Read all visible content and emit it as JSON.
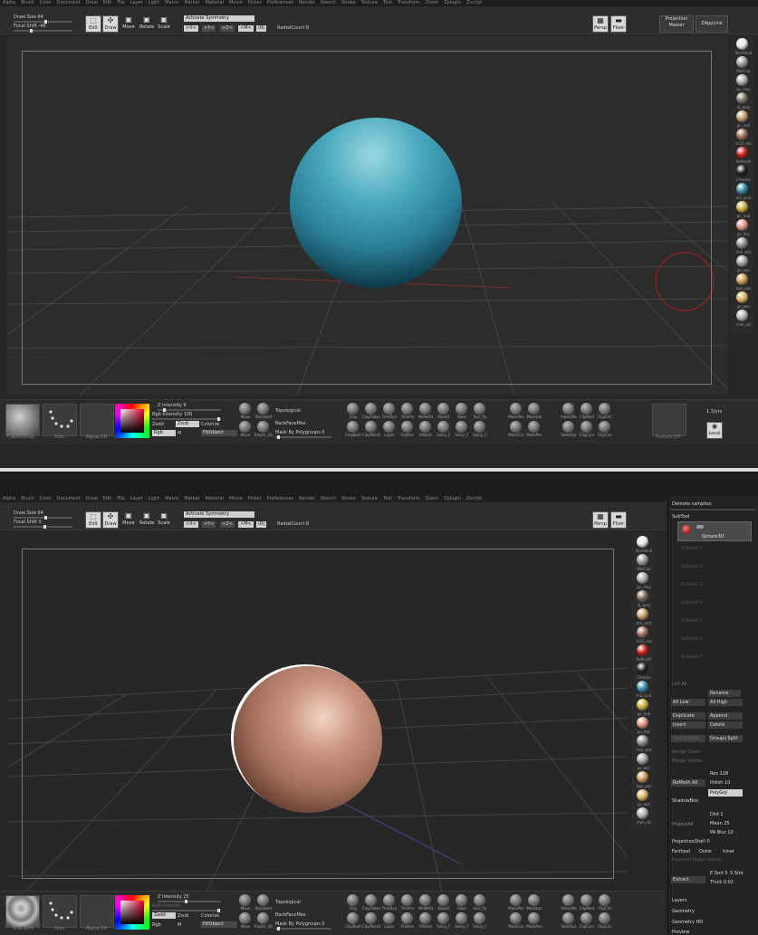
{
  "menu": [
    "Alpha",
    "Brush",
    "Color",
    "Document",
    "Draw",
    "Edit",
    "File",
    "Layer",
    "Light",
    "Macro",
    "Marker",
    "Material",
    "Movie",
    "Picker",
    "Preferences",
    "Render",
    "Stencil",
    "Stroke",
    "Texture",
    "Tool",
    "Transform",
    "Zoom",
    "Zplugin",
    "Zscript"
  ],
  "top1": {
    "draw_size": "Draw Size 64",
    "focal_shift": "Focal Shift -46",
    "symmetry": "Activate Symmetry",
    "axes": [
      ">X<",
      ">Y<",
      ">Z<",
      ">M<",
      "(R)"
    ],
    "radial": "RadialCount 8",
    "edit": "Edit",
    "draw": "Draw",
    "move": "Move",
    "rotate": "Rotate",
    "scale": "Scale",
    "persp": "Persp",
    "floor": "Floor",
    "projection": "Projection Master",
    "zapplink": "ZAppLink"
  },
  "top2": {
    "draw_size": "Draw Size 64",
    "focal_shift": "Focal Shift 0",
    "symmetry": "Activate Symmetry",
    "axes": [
      ">X<",
      ">Y<",
      ">Z<",
      ">M<",
      "(R)"
    ],
    "radial": "RadialCount 8",
    "edit": "Edit",
    "draw": "Draw",
    "move": "Move",
    "rotate": "Rotate",
    "scale": "Scale",
    "persp": "Persp",
    "floor": "Floor"
  },
  "materials1": [
    "SkinShad",
    "MatCap",
    "gv_may",
    "dj_grey",
    "gv_redi",
    "m22_ma",
    "ReflectR",
    "Chrome",
    "m2_ocul",
    "gv_hub",
    "gv_fmc",
    "mdl_wht",
    "gv_wor",
    "bgn_pas",
    "gv_wor",
    "mah_ski"
  ],
  "materials2": [
    "SkinShad",
    "MatCap",
    "gv_may",
    "dj_grey",
    "dm_redt",
    "m22_ma",
    "ReflectR",
    "Chrome",
    "m2_ocul",
    "gv_hub",
    "gv_fmc",
    "mdl_wht",
    "gv_wor",
    "bgn_pas",
    "gv_wor",
    "mah_ski"
  ],
  "colors": {
    "mat": [
      "#e8e8e8",
      "#9a9a9a",
      "#a8a8a8",
      "#7e6e60",
      "#c49a6a",
      "#a06a5a",
      "#c8201e",
      "#222222",
      "#3a8aa8",
      "#c8b040",
      "#e09080",
      "#8a8a8a",
      "#a0a0a0",
      "#c89850",
      "#d8b060",
      "#b0b0b0"
    ]
  },
  "bottom1": {
    "z_intensity": "Z Intensity 9",
    "rgb_intensity": "Rgb Intensity 100",
    "zadd": "Zadd",
    "zsub": "Zsub",
    "colorize": "Colorize",
    "rgb": "Rgb",
    "m": "M",
    "fillobject": "FillObject",
    "topological": "Topological",
    "backface": "BackFaceMas",
    "mask_poly": "Mask By Polygroups 0",
    "thumbs": [
      "ClayBuildup",
      "Dots",
      "Alpha Off"
    ],
    "brushes_top": [
      "Move",
      "Standard",
      "Clay",
      "ClayTubes",
      "TrimDyn",
      "TrimFro",
      "MalletFa",
      "Slash2",
      "Rake",
      "hair_fly",
      "MaskPen",
      "MaskLas",
      "SelectRe",
      "ClipRect",
      "ClipCirc"
    ],
    "brushes_bot": [
      "Move",
      "Elastic_Sh",
      "ClayBuilt",
      "ClayPolish",
      "Layer",
      "Flatten",
      "hPolish",
      "Selvy_F",
      "Selvy_F",
      "Selvy_F",
      "MaskCur",
      "MaskPen",
      "SelectLa",
      "ClipCurv",
      "ClipCirc"
    ],
    "tex": "Texture Off",
    "local": "Local",
    "persp_btn": "1.3/yrs"
  },
  "bottom2": {
    "z_intensity": "Z Intensity 25",
    "rgb_intensity": "Rgb Intensity",
    "zadd": "Zadd",
    "zsub": "Zsub",
    "colorize": "Colorize",
    "rgb": "Rgb",
    "m": "M",
    "fillobject": "FillObject",
    "topological": "Topological",
    "backface": "BackFaceMas",
    "mask_poly": "Mask By Polygroups 0",
    "thumbs": [
      "Standard",
      "Dots",
      "Alpha Off"
    ]
  },
  "subtool": {
    "header": "Demote camptoo",
    "title": "SubTool",
    "active": "Sphere3D",
    "slots": [
      "Subtool 1",
      "Subtool 2",
      "Subtool 3",
      "Subtool 4",
      "Subtool 5",
      "Subtool 6",
      "Subtool 7"
    ],
    "list_all": "List All",
    "rename": "Rename",
    "all_low": "All Low",
    "all_high": "All High",
    "duplicate": "Duplicate",
    "append": "Append",
    "insert": "Insert",
    "delete": "Delete",
    "split_hidden": "Split Hidden",
    "groups_split": "Groups Split",
    "merge_down": "Merge Down",
    "merge_visible": "Merge Visible",
    "remesh_all": "ReMesh All",
    "res": "Res 128",
    "polish": "Polish 10",
    "polygrp": "PolyGrp",
    "shadowbox": "ShadowBox",
    "project_all": "ProjectAll",
    "dist": "Dist 1",
    "mean": "Mean 25",
    "pa_blur": "PA Blur 10",
    "projection_shell": "ProjectionShell 0",
    "farthest": "Farthest",
    "outer": "Outer",
    "inner": "Inner",
    "reproject": "Reproject Higher Subdiv",
    "extract": "Extract",
    "e_smt": "E Smt 5",
    "s_smt": "S Smt",
    "thick": "Thick 0.02",
    "layers": "Layers",
    "geometry": "Geometry",
    "geometry_hd": "Geometry HD",
    "preview": "Preview"
  }
}
